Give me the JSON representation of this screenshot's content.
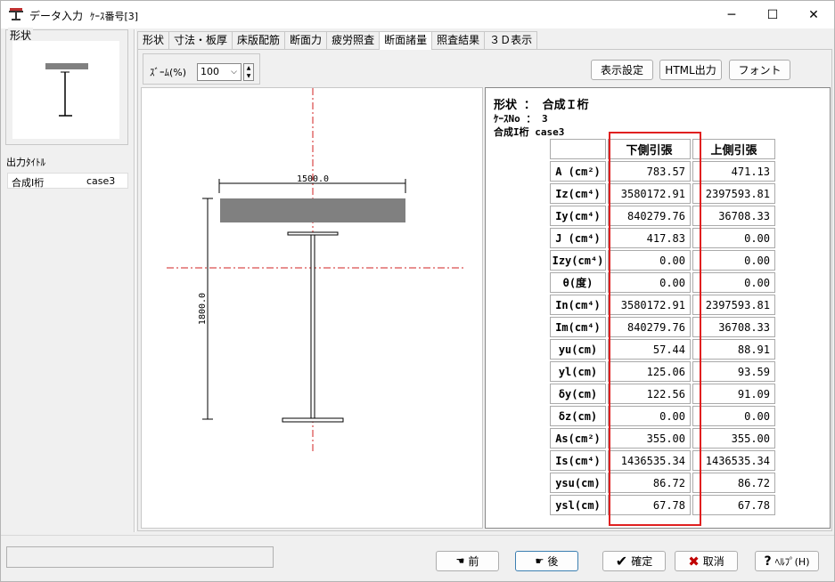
{
  "window": {
    "title": "データ入力",
    "subtitle": "ｹｰｽ番号[3]",
    "controls": [
      "─",
      "☐",
      "✕"
    ]
  },
  "left": {
    "shape_legend": "形状",
    "output_title_label": "出力ﾀｲﾄﾙ",
    "output_name": "合成I桁",
    "output_case": "case3"
  },
  "tabs": [
    "形状",
    "寸法・板厚",
    "床版配筋",
    "断面力",
    "疲労照査",
    "断面諸量",
    "照査結果",
    "３Ｄ表示"
  ],
  "active_tab": "断面諸量",
  "toolbar": {
    "zoom_label": "ｽﾞｰﾑ(%)",
    "zoom_value": "100",
    "display_settings": "表示設定",
    "html_output": "HTML出力",
    "font": "フォント"
  },
  "drawing": {
    "width_dim": "1500.0",
    "height_dim": "1800.0"
  },
  "results": {
    "shape_line": "形状 ： 合成Ｉ桁",
    "case_line": "ｹｰｽNo ： 3",
    "name_line": "合成I桁 case3",
    "col_lower": "下側引張",
    "col_upper": "上側引張",
    "rows": [
      {
        "label": "A (cm²)",
        "lower": "783.57",
        "upper": "471.13"
      },
      {
        "label": "Iz(cm⁴)",
        "lower": "3580172.91",
        "upper": "2397593.81"
      },
      {
        "label": "Iy(cm⁴)",
        "lower": "840279.76",
        "upper": "36708.33"
      },
      {
        "label": "J (cm⁴)",
        "lower": "417.83",
        "upper": "0.00"
      },
      {
        "label": "Izy(cm⁴)",
        "lower": "0.00",
        "upper": "0.00"
      },
      {
        "label": "θ(度)",
        "lower": "0.00",
        "upper": "0.00"
      },
      {
        "label": "In(cm⁴)",
        "lower": "3580172.91",
        "upper": "2397593.81"
      },
      {
        "label": "Im(cm⁴)",
        "lower": "840279.76",
        "upper": "36708.33"
      },
      {
        "label": "yu(cm)",
        "lower": "57.44",
        "upper": "88.91"
      },
      {
        "label": "yl(cm)",
        "lower": "125.06",
        "upper": "93.59"
      },
      {
        "label": "δy(cm)",
        "lower": "122.56",
        "upper": "91.09"
      },
      {
        "label": "δz(cm)",
        "lower": "0.00",
        "upper": "0.00"
      },
      {
        "label": "As(cm²)",
        "lower": "355.00",
        "upper": "355.00"
      },
      {
        "label": "Is(cm⁴)",
        "lower": "1436535.34",
        "upper": "1436535.34"
      },
      {
        "label": "ysu(cm)",
        "lower": "86.72",
        "upper": "86.72"
      },
      {
        "label": "ysl(cm)",
        "lower": "67.78",
        "upper": "67.78"
      }
    ]
  },
  "buttons": {
    "prev": "前",
    "next": "後",
    "ok": "確定",
    "cancel": "取消",
    "help": "ﾍﾙﾌﾟ(H)"
  },
  "colors": {
    "highlight": "#e02020",
    "axis": "#d02020",
    "slab": "#808080"
  }
}
